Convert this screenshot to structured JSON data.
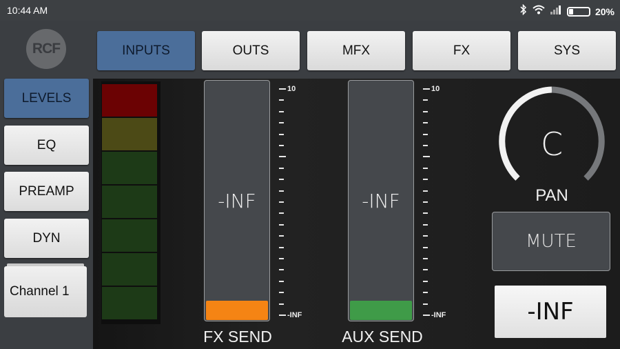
{
  "status_bar": {
    "time": "10:44 AM",
    "battery_percent": "20%",
    "battery_level": 0.2,
    "icons": [
      "bluetooth-icon",
      "wifi-icon",
      "signal-icon",
      "battery-icon"
    ]
  },
  "logo": {
    "text": "RCF"
  },
  "sidebar": {
    "items": [
      {
        "label": "LEVELS",
        "active": true
      },
      {
        "label": "EQ",
        "active": false
      },
      {
        "label": "PREAMP",
        "active": false
      },
      {
        "label": "DYN",
        "active": false
      }
    ],
    "channel_name": "Channel 1"
  },
  "tabs": [
    {
      "label": "INPUTS",
      "active": true
    },
    {
      "label": "OUTS",
      "active": false
    },
    {
      "label": "MFX",
      "active": false
    },
    {
      "label": "FX",
      "active": false
    },
    {
      "label": "SYS",
      "active": false
    }
  ],
  "meter": {
    "segment_colors": [
      "#6b0203",
      "#4c4a16",
      "#1d3a17",
      "#1d3a17",
      "#1d3a17",
      "#1d3a17",
      "#1d3a17"
    ]
  },
  "faders": {
    "fx_send": {
      "value": "-INF",
      "label": "FX SEND",
      "handle_color": "#f58414"
    },
    "aux_send": {
      "value": "-INF",
      "label": "AUX SEND",
      "handle_color": "#3f9b48"
    }
  },
  "scale_labels": {
    "top": "10",
    "bottom": "-INF"
  },
  "pan": {
    "value": "C",
    "label": "PAN"
  },
  "mute": {
    "label": "MUTE"
  },
  "channel_level": {
    "value": "-INF"
  },
  "colors": {
    "accent_blue": "#4b6e9a",
    "background": "#3a3d41",
    "panel": "#1c1c1c"
  }
}
